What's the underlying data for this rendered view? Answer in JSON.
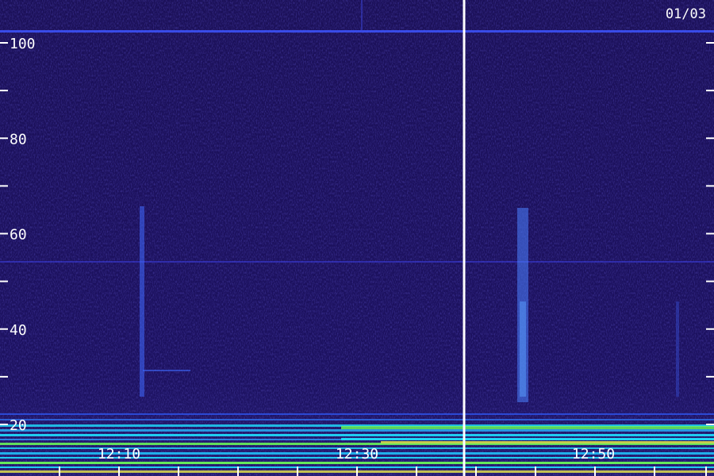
{
  "chart_data": {
    "type": "heatmap",
    "date_label": "01/03",
    "y_ticks": [
      20,
      40,
      60,
      80,
      100
    ],
    "y_minor_ticks": [
      30,
      50,
      70,
      90
    ],
    "ylim": [
      18,
      108
    ],
    "x_ticks": [
      "12:10",
      "12:30",
      "12:50"
    ],
    "colors": {
      "background": "#1a0f52",
      "noise_low": "#120a3a",
      "noise_high": "#3b2fc4",
      "band": "#1fe0ff",
      "band_hot": "#6cff58",
      "band_yellow": "#e8e84a",
      "divider": "#ffffff"
    }
  }
}
